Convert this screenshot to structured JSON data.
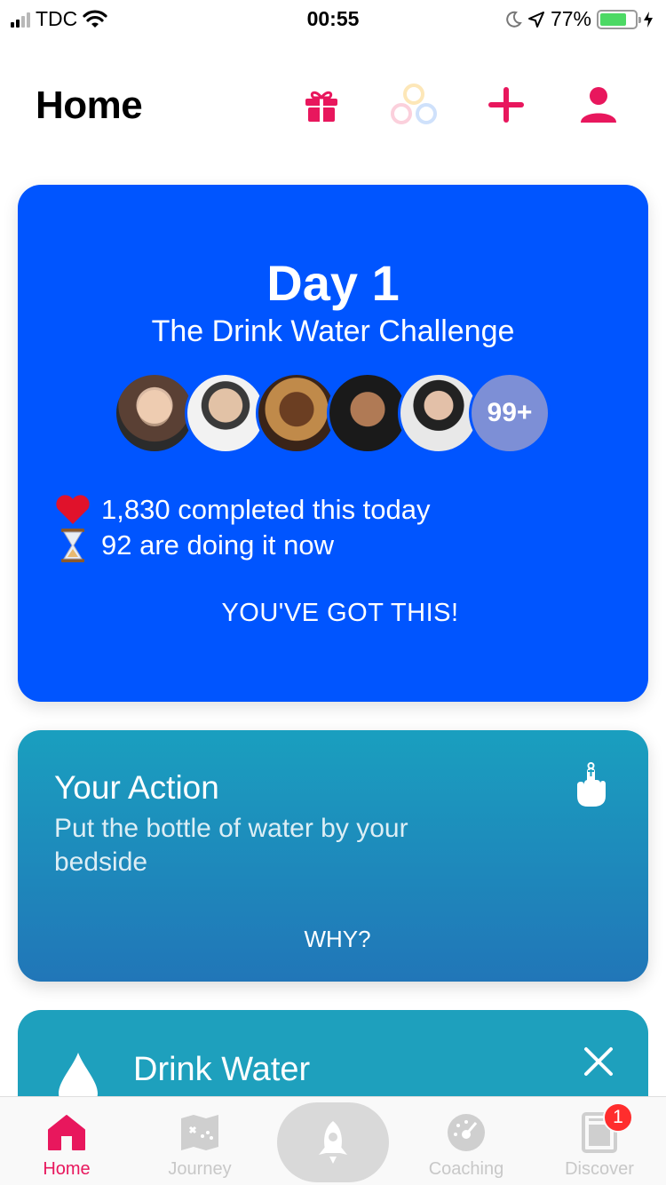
{
  "status_bar": {
    "carrier": "TDC",
    "time": "00:55",
    "battery_percent": "77%"
  },
  "header": {
    "title": "Home",
    "icons": [
      "gift-icon",
      "circles-icon",
      "plus-icon",
      "profile-icon"
    ],
    "accent_color": "#e8175d"
  },
  "challenge_card": {
    "day": "Day 1",
    "name": "The Drink Water Challenge",
    "avatars_more": "99+",
    "completed_text": "1,830 completed this today",
    "doing_text": "92 are doing it now",
    "cta": "YOU'VE GOT THIS!",
    "color": "#0055ff"
  },
  "action_card": {
    "title": "Your Action",
    "description": "Put the bottle of water by your bedside",
    "why_label": "WHY?"
  },
  "drink_card": {
    "title": "Drink Water"
  },
  "tab_bar": {
    "tabs": [
      {
        "label": "Home",
        "icon": "home-icon",
        "active": true
      },
      {
        "label": "Journey",
        "icon": "map-icon",
        "active": false
      },
      {
        "label": "",
        "icon": "rocket-icon",
        "active": false
      },
      {
        "label": "Coaching",
        "icon": "gauge-icon",
        "active": false
      },
      {
        "label": "Discover",
        "icon": "discover-icon",
        "active": false
      }
    ],
    "discover_badge": "1"
  }
}
